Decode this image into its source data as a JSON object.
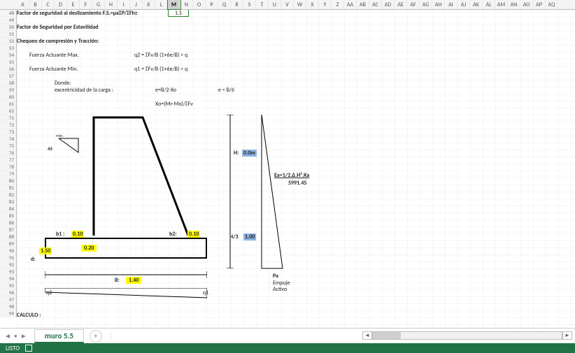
{
  "columns": [
    "A",
    "B",
    "C",
    "D",
    "E",
    "F",
    "G",
    "H",
    "I",
    "J",
    "K",
    "L",
    "M",
    "N",
    "O",
    "P",
    "Q",
    "R",
    "S",
    "T",
    "U",
    "V",
    "W",
    "X",
    "Y",
    "Z",
    "AA",
    "AB",
    "AC",
    "AD",
    "AE",
    "AF",
    "AG",
    "AH",
    "AI",
    "AJ",
    "AK",
    "AL",
    "AM",
    "AN",
    "AO",
    "AP",
    "AQ"
  ],
  "selected_col_index": 12,
  "rows_start": 48,
  "rows": [
    "48",
    "49",
    "50",
    "51",
    "52",
    "53",
    "54",
    "55",
    "56",
    "57",
    "58",
    "59",
    "60",
    "61",
    "62",
    "71",
    "72",
    "73",
    "74",
    "75",
    "76",
    "77",
    "78",
    "79",
    "80",
    "81",
    "82",
    "83",
    "84",
    "85",
    "86",
    "87",
    "88",
    "89",
    "90",
    "91",
    "92",
    "93",
    "94",
    "95",
    "96",
    "97",
    "98",
    "99"
  ],
  "text": {
    "r48": "Factor de seguridad al deslizamiento F.S.=μxΣP/ΣFh≥",
    "r48_val": "1.5",
    "r50": "Factor de Seguridad por Estavilidad",
    "r52": "Chequeo de compresión y Tracción:",
    "r54a": "Fuerza Actuante Max.",
    "r54b": "q2 = ΣFv/B (1+6e/B) < q",
    "r56a": "Fuerza Actuante Min.",
    "r56b": "q1 = ΣFv/B (1+6e/B) < q",
    "r58": "Donde:",
    "r59a": "excentricidad de la carga :",
    "r59b": "e=B/2-Xo",
    "r59c": "e < B/6",
    "r61": "Xo=(Mr-Mo)/ΣFv",
    "min_lbl": "min.",
    "fortyfive": "45",
    "b1_lbl": "b1 :",
    "b1_val": "0.10",
    "b2_lbl": "b2:",
    "b2_val": "0.10",
    "d_lbl": "d:",
    "d_val": "1.50",
    "base_val": "0.20",
    "B_lbl": "B:",
    "B_val": "1.40",
    "q1_lbl": "q1",
    "q2_lbl": "q2",
    "H_lbl": "H:",
    "H_val": "0.0m",
    "H3_lbl": "H/3",
    "H3_val": "1.00",
    "Ea_lbl": "Ea=1/2.Δ.H².Ka",
    "Ea_val": "5991.45",
    "Pa_lbl": "Pa",
    "Empuje_lbl": "Empuje",
    "Activo_lbl": "Activo",
    "calc_lbl": "CALCULO :"
  },
  "tabs": {
    "sheet1": "muro 5.5",
    "add": "+"
  },
  "status": {
    "ready": "LISTO"
  }
}
